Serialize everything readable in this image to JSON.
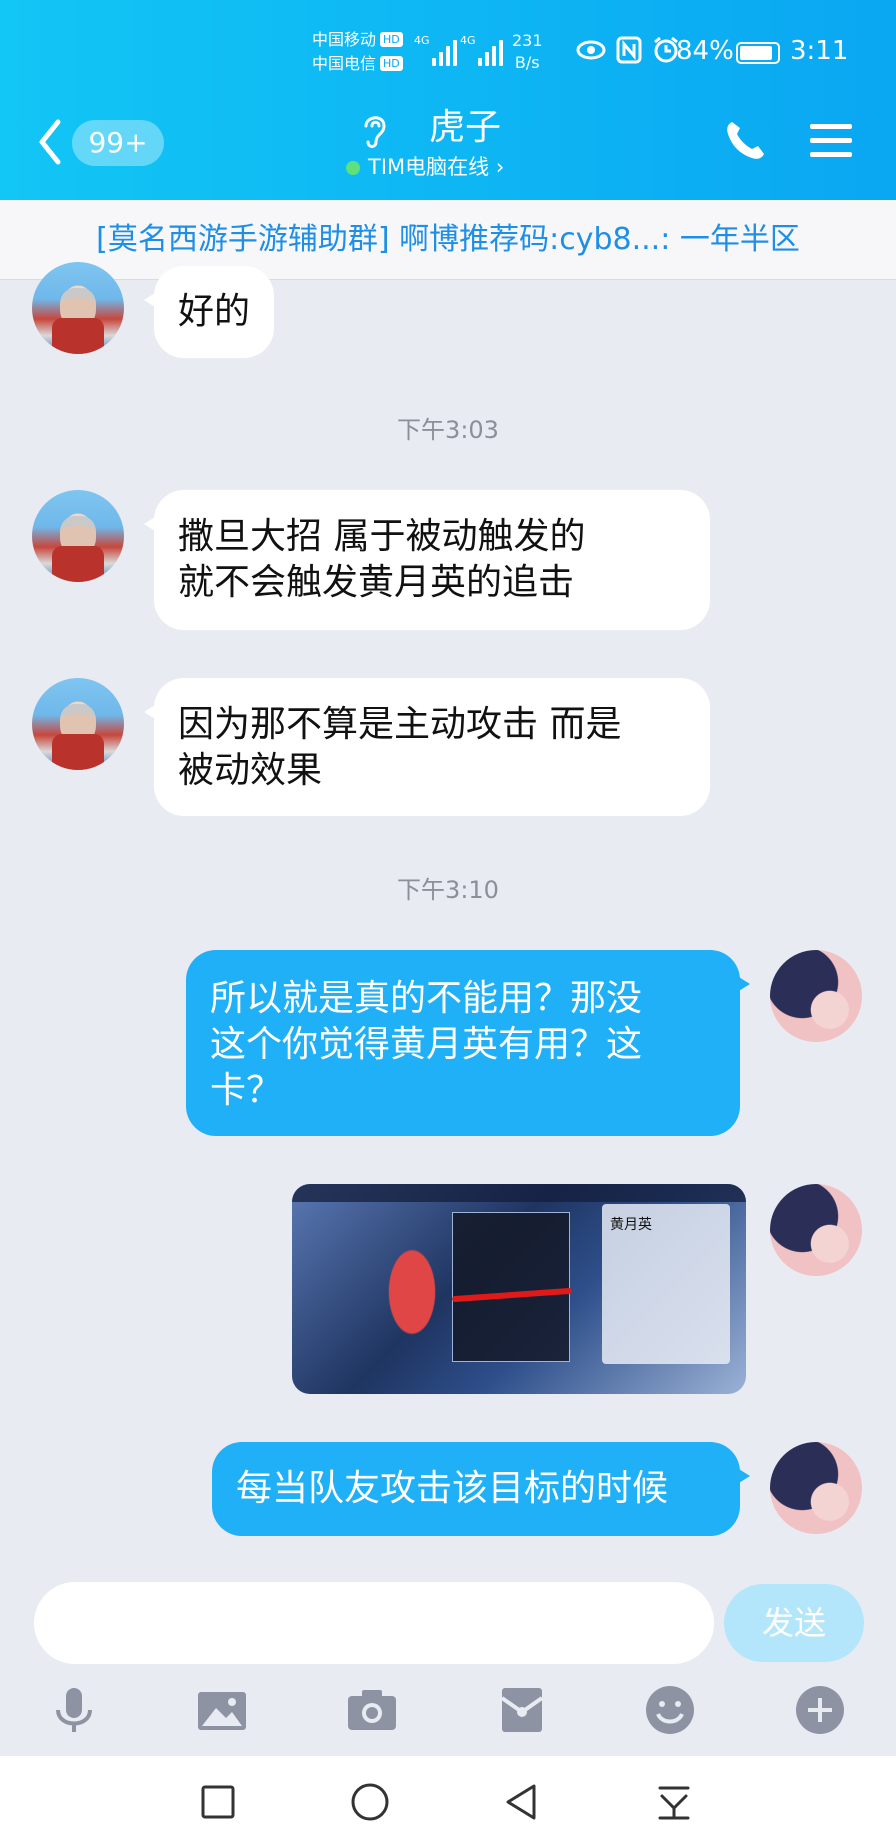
{
  "status_bar": {
    "carrier1": "中国移动",
    "carrier2": "中国电信",
    "hd": "HD",
    "net1": "4G",
    "net2": "4G",
    "speed_value": "231",
    "speed_unit": "B/s",
    "battery": "84%",
    "time": "3:11"
  },
  "header": {
    "unread_count": "99+",
    "title": "虎子",
    "subtitle": "TIM电脑在线 ›"
  },
  "notice": {
    "text": "[莫名西游手游辅助群] 啊博推荐码:cyb8...:  一年半区"
  },
  "messages": [
    {
      "side": "in",
      "text": "好的"
    },
    {
      "type": "time",
      "text": "下午3:03"
    },
    {
      "side": "in",
      "line1": "撒旦大招  属于被动触发的",
      "line2": "就不会触发黄月英的追击"
    },
    {
      "side": "in",
      "line1": "因为那不算是主动攻击  而是",
      "line2": "被动效果"
    },
    {
      "type": "time",
      "text": "下午3:10"
    },
    {
      "side": "out",
      "line1": "所以就是真的不能用？那没",
      "line2": "这个你觉得黄月英有用？这",
      "line3": "卡？"
    },
    {
      "side": "out",
      "type": "image",
      "caption": "黄月英"
    },
    {
      "side": "out",
      "text": "每当队友攻击该目标的时候"
    }
  ],
  "composer": {
    "input_value": "",
    "send_label": "发送"
  },
  "toolbar_icons": [
    "microphone-icon",
    "image-icon",
    "camera-icon",
    "red-packet-icon",
    "emoji-icon",
    "plus-icon"
  ],
  "nav_icons": [
    "square-icon",
    "circle-icon",
    "back-triangle-icon",
    "notification-pull-icon"
  ],
  "colors": {
    "header": "#0aa7f2",
    "bubble_out": "#1fb0f7",
    "bubble_in": "#ffffff",
    "notice_text": "#1f8fe6",
    "send_disabled": "#b3e6fb"
  }
}
